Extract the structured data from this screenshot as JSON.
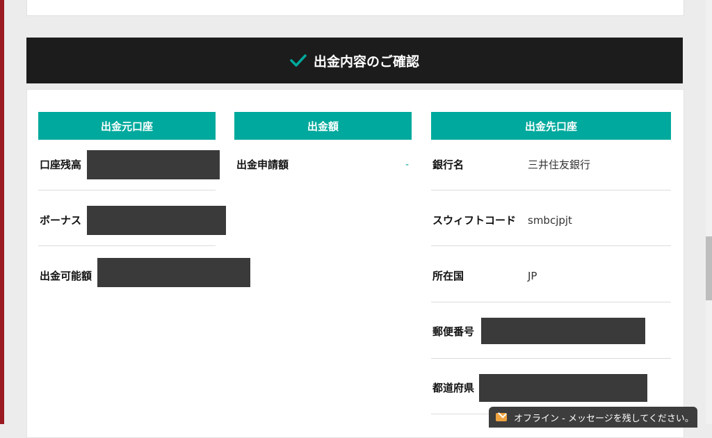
{
  "banner": {
    "title": "出金内容のご確認",
    "icon": "checkmark-icon"
  },
  "source_account": {
    "header": "出金元口座",
    "rows": [
      {
        "label": "口座残高"
      },
      {
        "label": "ボーナス"
      },
      {
        "label": "出金可能額"
      }
    ]
  },
  "amount": {
    "header": "出金額",
    "rows": [
      {
        "label": "出金申請額",
        "value": "-"
      }
    ]
  },
  "destination_account": {
    "header": "出金先口座",
    "rows": [
      {
        "label": "銀行名",
        "value": "三井住友銀行"
      },
      {
        "label": "スウィフトコード",
        "value": "smbcjpjt"
      },
      {
        "label": "所在国",
        "value": "JP"
      },
      {
        "label": "郵便番号"
      },
      {
        "label": "都道府県"
      }
    ]
  },
  "chat": {
    "text": "オフライン - メッセージを残してください。",
    "icon": "mail-icon"
  },
  "colors": {
    "accent": "#00a99d",
    "banner_bg": "#1c1c1c",
    "stripe": "#9b1b22"
  }
}
